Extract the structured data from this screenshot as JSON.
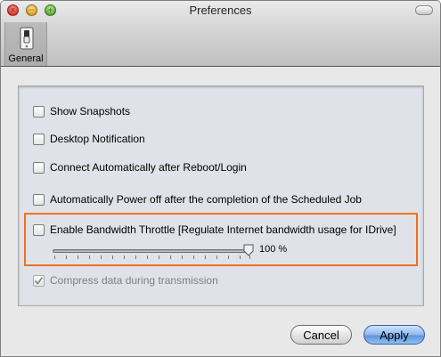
{
  "window": {
    "title": "Preferences",
    "traffic_lights": [
      "close-icon",
      "minimize-icon",
      "zoom-icon"
    ]
  },
  "toolbar": {
    "items": [
      {
        "label": "General",
        "icon": "general-switch-icon",
        "selected": true
      }
    ]
  },
  "options": [
    {
      "label": "Show Snapshots",
      "checked": false,
      "enabled": true
    },
    {
      "label": "Desktop Notification",
      "checked": false,
      "enabled": true
    },
    {
      "label": "Connect Automatically after Reboot/Login",
      "checked": false,
      "enabled": true
    },
    {
      "label": "Automatically Power off after the completion of the Scheduled Job",
      "checked": false,
      "enabled": true
    },
    {
      "label": "Enable Bandwidth Throttle [Regulate Internet bandwidth usage for IDrive]",
      "checked": false,
      "enabled": true,
      "highlighted": true
    },
    {
      "label": "Compress data during transmission",
      "checked": true,
      "enabled": false
    }
  ],
  "bandwidth_slider": {
    "value_label": "100 %",
    "value_percent": 100
  },
  "buttons": {
    "cancel": "Cancel",
    "apply": "Apply"
  },
  "colors": {
    "highlight": "#f26f22",
    "default_button": "#5e93da"
  }
}
